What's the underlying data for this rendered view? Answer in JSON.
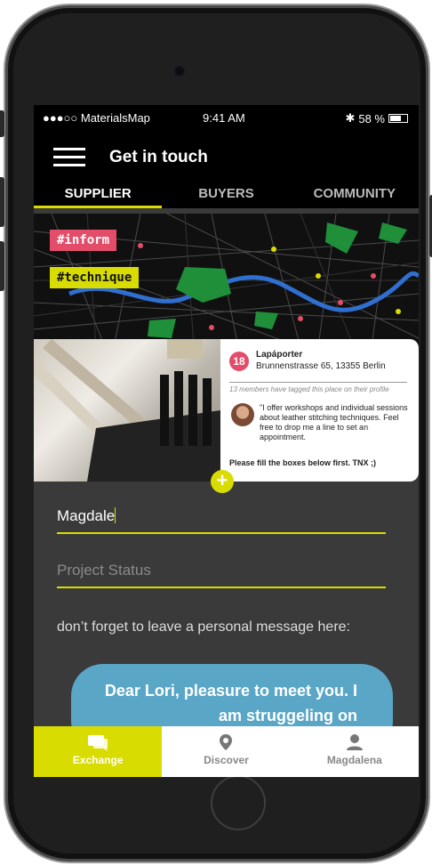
{
  "status_bar": {
    "carrier": "●●●○○ MaterialsMap",
    "time": "9:41 AM",
    "battery": "58 %",
    "battery_level": 0.58
  },
  "header": {
    "title": "Get in touch"
  },
  "tabs": [
    {
      "label": "SUPPLIER",
      "active": true
    },
    {
      "label": "BUYERS",
      "active": false
    },
    {
      "label": "COMMUNITY",
      "active": false
    }
  ],
  "map_tags": [
    {
      "label": "#inform",
      "color": "#e34d6a"
    },
    {
      "label": "#technique",
      "color": "#d9dc00"
    }
  ],
  "place_card": {
    "badge_count": "18",
    "name": "Lapáporter",
    "address": "Brunnenstrasse 65, 13355 Berlin",
    "members_note": "13 members have tagged this place on their profile",
    "quote": "\"I offer workshops and individual sessions about leather stitching techniques. Feel free to drop me a line to set an appointment.",
    "fill_note": "Please fill the boxes below first. TNX ;)"
  },
  "form": {
    "name_value": "Magdale",
    "status_placeholder": "Project Status",
    "message_prompt": "don’t forget to leave a personal message here:",
    "message_bubble": "Dear Lori, pleasure to meet you. I am struggeling on"
  },
  "bottom_nav": [
    {
      "label": "Exchange",
      "icon": "chat-icon",
      "active": true
    },
    {
      "label": "Discover",
      "icon": "location-pin-icon",
      "active": false
    },
    {
      "label": "Magdalena",
      "icon": "user-icon",
      "active": false
    }
  ],
  "colors": {
    "accent": "#d9dc00",
    "tag_pink": "#e34d6a",
    "bubble": "#5aa6c6",
    "screen_bg": "#3a3a3a"
  }
}
